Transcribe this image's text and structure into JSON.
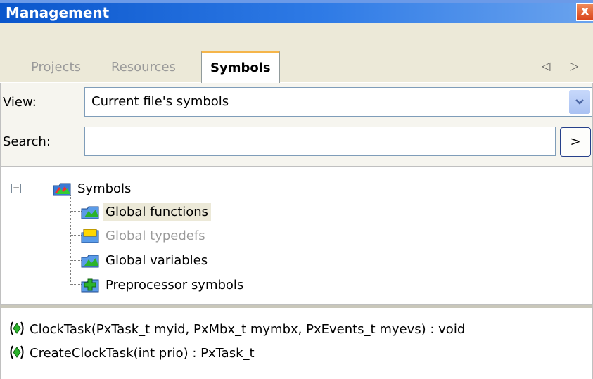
{
  "window": {
    "title": "Management",
    "close_label": "x"
  },
  "tabs": [
    {
      "label": "Projects",
      "active": false
    },
    {
      "label": "Resources",
      "active": false
    },
    {
      "label": "Symbols",
      "active": true
    }
  ],
  "tab_nav": {
    "prev": "◁",
    "next": "▷"
  },
  "view": {
    "label": "View:",
    "value": "Current file's symbols"
  },
  "search": {
    "label": "Search:",
    "value": "",
    "button": ">"
  },
  "tree": {
    "root": "Symbols",
    "children": [
      {
        "label": "Global functions",
        "selected": true,
        "enabled": true
      },
      {
        "label": "Global typedefs",
        "selected": false,
        "enabled": false
      },
      {
        "label": "Global variables",
        "selected": false,
        "enabled": true
      },
      {
        "label": "Preprocessor symbols",
        "selected": false,
        "enabled": true
      }
    ]
  },
  "symbols": [
    "ClockTask(PxTask_t myid, PxMbx_t mymbx, PxEvents_t myevs) : void",
    "CreateClockTask(int prio) : PxTask_t"
  ]
}
